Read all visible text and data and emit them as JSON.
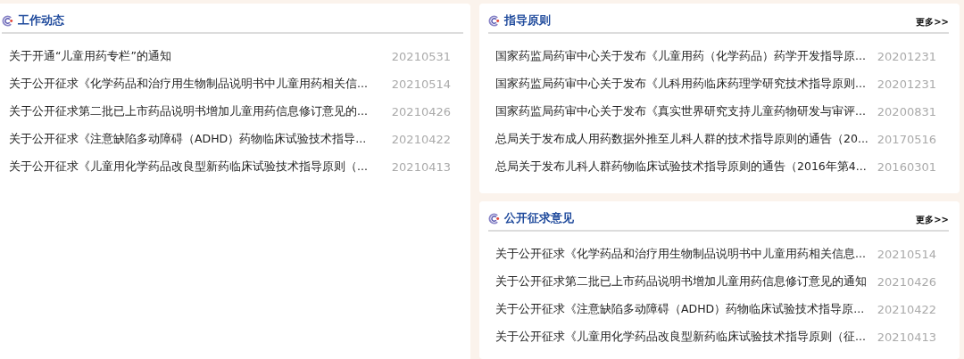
{
  "panels": [
    {
      "title": "工作动态",
      "items": [
        {
          "text": "关于开通“儿童用药专栏”的通知",
          "date": "20210531"
        },
        {
          "text": "关于公开征求《化学药品和治疗用生物制品说明书中儿童用药相关信...",
          "date": "20210514"
        },
        {
          "text": "关于公开征求第二批已上市药品说明书增加儿童用药信息修订意见的...",
          "date": "20210426"
        },
        {
          "text": "关于公开征求《注意缺陷多动障碍（ADHD）药物临床试验技术指导...",
          "date": "20210422"
        },
        {
          "text": "关于公开征求《儿童用化学药品改良型新药临床试验技术指导原则（...",
          "date": "20210413"
        }
      ]
    },
    {
      "title": "指导原则",
      "more": "更多>>",
      "items": [
        {
          "text": "国家药监局药审中心关于发布《儿童用药（化学药品）药学开发指导原...",
          "date": "20201231"
        },
        {
          "text": "国家药监局药审中心关于发布《儿科用药临床药理学研究技术指导原则...",
          "date": "20201231"
        },
        {
          "text": "国家药监局药审中心关于发布《真实世界研究支持儿童药物研发与审评...",
          "date": "20200831"
        },
        {
          "text": "总局关于发布成人用药数据外推至儿科人群的技术指导原则的通告（20...",
          "date": "20170516"
        },
        {
          "text": "总局关于发布儿科人群药物临床试验技术指导原则的通告（2016年第4...",
          "date": "20160301"
        }
      ]
    },
    {
      "title": "公开征求意见",
      "more": "更多>>",
      "items": [
        {
          "text": "关于公开征求《化学药品和治疗用生物制品说明书中儿童用药相关信息...",
          "date": "20210514"
        },
        {
          "text": "关于公开征求第二批已上市药品说明书增加儿童用药信息修订意见的通知",
          "date": "20210426"
        },
        {
          "text": "关于公开征求《注意缺陷多动障碍（ADHD）药物临床试验技术指导原...",
          "date": "20210422"
        },
        {
          "text": "关于公开征求《儿童用化学药品改良型新药临床试验技术指导原则（征...",
          "date": "20210413"
        }
      ]
    }
  ]
}
